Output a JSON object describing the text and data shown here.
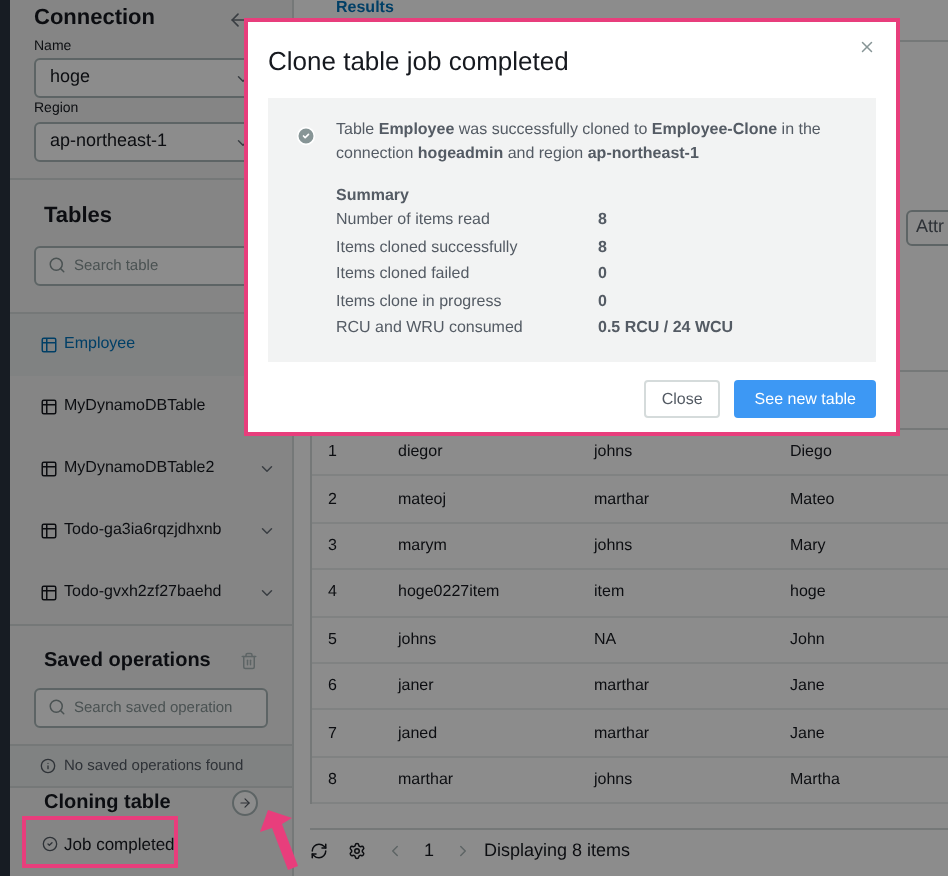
{
  "sidebar": {
    "connection": {
      "title": "Connection",
      "name_label": "Name",
      "name_value": "hoge",
      "region_label": "Region",
      "region_value": "ap-northeast-1"
    },
    "tables": {
      "title": "Tables",
      "search_placeholder": "Search table",
      "items": [
        {
          "label": "Employee",
          "selected": true
        },
        {
          "label": "MyDynamoDBTable",
          "selected": false
        },
        {
          "label": "MyDynamoDBTable2",
          "selected": false
        },
        {
          "label": "Todo-ga3ia6rqzjdhxnb",
          "selected": false
        },
        {
          "label": "Todo-gvxh2zf27baehd",
          "selected": false
        }
      ]
    },
    "saved_operations": {
      "title": "Saved operations",
      "search_placeholder": "Search saved operation",
      "empty_message": "No saved operations found"
    },
    "cloning": {
      "title": "Cloning table",
      "status": "Job completed"
    }
  },
  "main": {
    "tab": "Results",
    "attr_button": "Attr",
    "table": {
      "rows": [
        [
          "1",
          "diegor",
          "johns",
          "Diego"
        ],
        [
          "2",
          "mateoj",
          "marthar",
          "Mateo"
        ],
        [
          "3",
          "marym",
          "johns",
          "Mary"
        ],
        [
          "4",
          "hoge0227item",
          "item",
          "hoge"
        ],
        [
          "5",
          "johns",
          "NA",
          "John"
        ],
        [
          "6",
          "janer",
          "marthar",
          "Jane"
        ],
        [
          "7",
          "janed",
          "marthar",
          "Jane"
        ],
        [
          "8",
          "marthar",
          "johns",
          "Martha"
        ]
      ]
    },
    "footer": {
      "page": "1",
      "status": "Displaying 8 items"
    }
  },
  "dialog": {
    "title": "Clone table job completed",
    "message": "Table **Employee** was successfully cloned to **Employee-Clone** in the connection **hogeadmin** and region **ap-northeast-1**",
    "summary_title": "Summary",
    "summary": [
      {
        "label": "Number of items read",
        "value": "8"
      },
      {
        "label": "Items cloned successfully",
        "value": "8"
      },
      {
        "label": "Items cloned failed",
        "value": "0"
      },
      {
        "label": "Items clone in progress",
        "value": "0"
      },
      {
        "label": "RCU and WRU consumed",
        "value": "0.5 RCU / 24 WCU"
      }
    ],
    "buttons": [
      {
        "label": "Close",
        "kind": "secondary"
      },
      {
        "label": "See new table",
        "kind": "primary"
      }
    ]
  }
}
